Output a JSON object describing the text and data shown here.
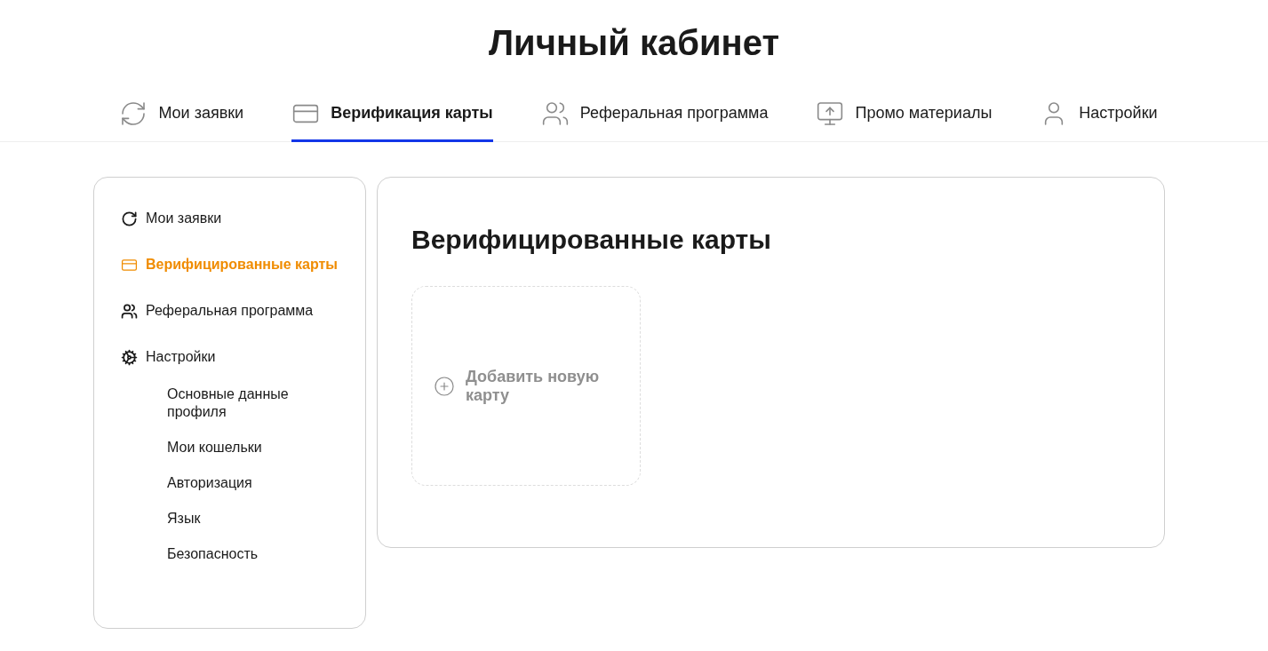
{
  "page_title": "Личный кабинет",
  "tabs": [
    {
      "label": "Мои заявки",
      "selected": false
    },
    {
      "label": "Верификация карты",
      "selected": true
    },
    {
      "label": "Реферальная программа",
      "selected": false
    },
    {
      "label": "Промо материалы",
      "selected": false
    },
    {
      "label": "Настройки",
      "selected": false
    }
  ],
  "sidebar": {
    "items": [
      {
        "label": "Мои заявки",
        "selected": false
      },
      {
        "label": "Верифицированные карты",
        "selected": true
      },
      {
        "label": "Реферальная программа",
        "selected": false
      },
      {
        "label": "Настройки",
        "selected": false,
        "children": [
          {
            "label": "Основные данные профиля",
            "selected": false
          },
          {
            "label": "Мои кошельки",
            "selected": false
          },
          {
            "label": "Авторизация",
            "selected": false
          },
          {
            "label": "Язык",
            "selected": false
          },
          {
            "label": "Безопасность",
            "selected": false
          }
        ]
      }
    ]
  },
  "content": {
    "title": "Верифицированные карты",
    "add_card": {
      "label": "Добавить новую карту"
    }
  }
}
